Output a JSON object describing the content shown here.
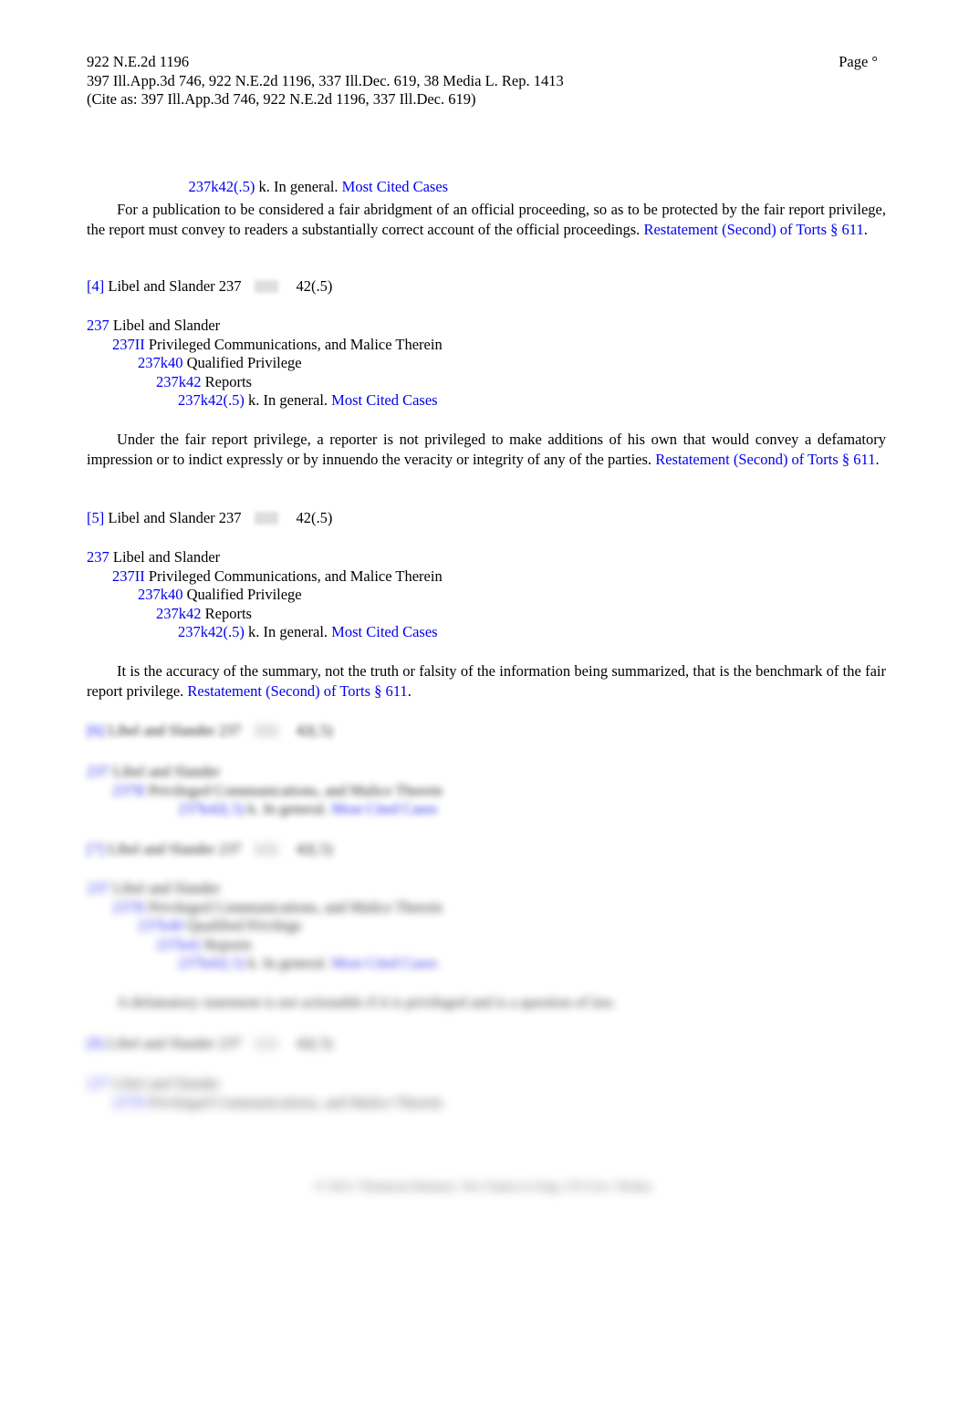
{
  "document": {
    "header": {
      "citation_primary": "922 N.E.2d 1196",
      "page_label": "Page °",
      "citation_parallel": "397 Ill.App.3d 746, 922 N.E.2d 1196, 337 Ill.Dec. 619, 38 Media L. Rep. 1413",
      "cite_as": "(Cite as: 397 Ill.App.3d 746, 922 N.E.2d 1196, 337 Ill.Dec. 619)"
    },
    "top_key_line": {
      "key_number": "237k42(.5)",
      "text": " k. In general. ",
      "most_cited": "Most Cited Cases"
    },
    "paragraphs": {
      "p3": {
        "text": "For a publication to be considered a fair abridgment of an official proceeding, so as to be protected by the fair report privilege, the report must convey to readers a substantially correct account of the official proceedings. ",
        "citation": "Restatement (Second) of Torts § 611",
        "tail": "."
      },
      "p4": {
        "text": "Under the fair report privilege, a reporter is not privileged to make additions of his own that would convey a defamatory impression or to indict expressly or by innuendo the veracity or integrity of any of the parties. ",
        "citation": "Restatement (Second) of Torts § 611",
        "tail": "."
      },
      "p5": {
        "text": "It is the accuracy of the summary, not the truth or falsity of the information being summarized, that is the benchmark of the fair report privilege. ",
        "citation": "Restatement (Second) of Torts § 611",
        "tail": "."
      },
      "p_blur": {
        "text": "A defamatory statement is not actionable if it is privileged and is a question of law."
      }
    },
    "headnotes": [
      {
        "marker": "[4]",
        "topic": " Libel and Slander 237",
        "key_icon": "key-icon",
        "subsection": "42(.5)",
        "hierarchy": [
          {
            "num": "237",
            "label": " Libel and Slander",
            "indent": "h0"
          },
          {
            "num": "237II",
            "label": " Privileged Communications, and Malice Therein",
            "indent": "h1"
          },
          {
            "num": "237k40",
            "label": " Qualified Privilege",
            "indent": "h2"
          },
          {
            "num": "237k42",
            "label": " Reports",
            "indent": "h3"
          },
          {
            "num": "237k42(.5)",
            "label": " k. In general. ",
            "indent": "h4",
            "most_cited": "Most Cited Cases"
          }
        ]
      },
      {
        "marker": "[5]",
        "topic": " Libel and Slander 237",
        "key_icon": "key-icon",
        "subsection": "42(.5)",
        "hierarchy": [
          {
            "num": "237",
            "label": " Libel and Slander",
            "indent": "h0"
          },
          {
            "num": "237II",
            "label": " Privileged Communications, and Malice Therein",
            "indent": "h1"
          },
          {
            "num": "237k40",
            "label": " Qualified Privilege",
            "indent": "h2"
          },
          {
            "num": "237k42",
            "label": " Reports",
            "indent": "h3"
          },
          {
            "num": "237k42(.5)",
            "label": " k. In general. ",
            "indent": "h4",
            "most_cited": "Most Cited Cases"
          }
        ]
      },
      {
        "marker": "[6]",
        "topic": " Libel and Slander 237",
        "key_icon": "key-icon",
        "subsection": "42(.5)",
        "hierarchy": [
          {
            "num": "237",
            "label": " Libel and Slander",
            "indent": "h0"
          },
          {
            "num": "237II",
            "label": " Privileged Communications, and Malice Therein",
            "indent": "h1"
          },
          {
            "num": "237k42(.5)",
            "label": " k. In general. ",
            "indent": "h4",
            "most_cited": "Most Cited Cases"
          }
        ]
      },
      {
        "marker": "[7]",
        "topic": " Libel and Slander 237",
        "key_icon": "key-icon",
        "subsection": "42(.5)",
        "hierarchy": [
          {
            "num": "237",
            "label": " Libel and Slander",
            "indent": "h0"
          },
          {
            "num": "237II",
            "label": " Privileged Communications, and Malice Therein",
            "indent": "h1"
          },
          {
            "num": "237k40",
            "label": " Qualified Privilege",
            "indent": "h2"
          },
          {
            "num": "237k42",
            "label": " Reports",
            "indent": "h3"
          },
          {
            "num": "237k42(.5)",
            "label": " k. In general. ",
            "indent": "h4",
            "most_cited": "Most Cited Cases"
          }
        ]
      },
      {
        "marker": "[8]",
        "topic": " Libel and Slander 237",
        "key_icon": "key-icon",
        "subsection": "42(.5)",
        "hierarchy": [
          {
            "num": "237",
            "label": " Libel and Slander",
            "indent": "h0"
          },
          {
            "num": "237II",
            "label": " Privileged Communications, and Malice Therein",
            "indent": "h1"
          }
        ]
      }
    ],
    "footer": {
      "copyright": "© 2011 Thomson Reuters. No Claim to Orig. US Gov. Works."
    },
    "colors": {
      "link": "#0000ee",
      "text": "#000000",
      "background": "#ffffff"
    }
  }
}
